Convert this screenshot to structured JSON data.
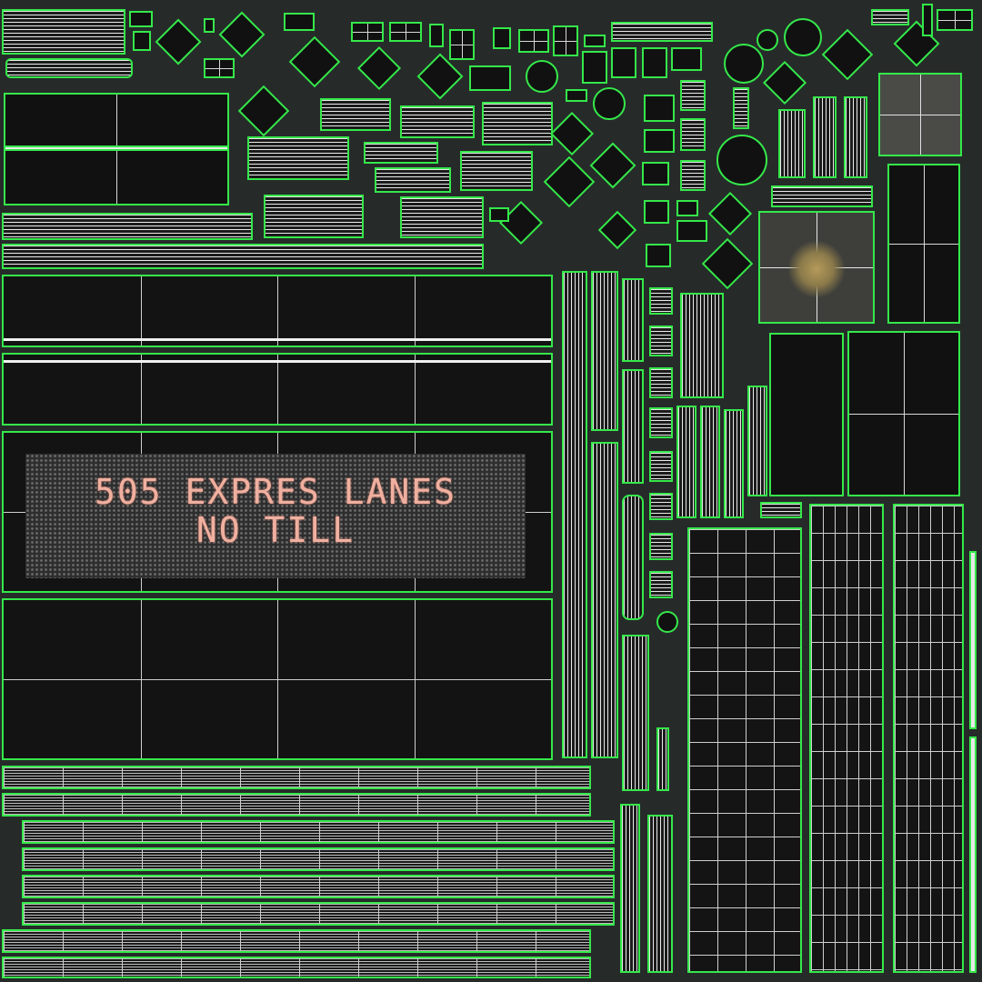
{
  "vms_sign": {
    "line1": "505 EXPRES LANES",
    "line2": "NO TILL"
  },
  "colors": {
    "background": "#262b2a",
    "uv_outline": "#35e84a",
    "panel_fill": "#131313",
    "led_text": "#f0b0a0"
  }
}
